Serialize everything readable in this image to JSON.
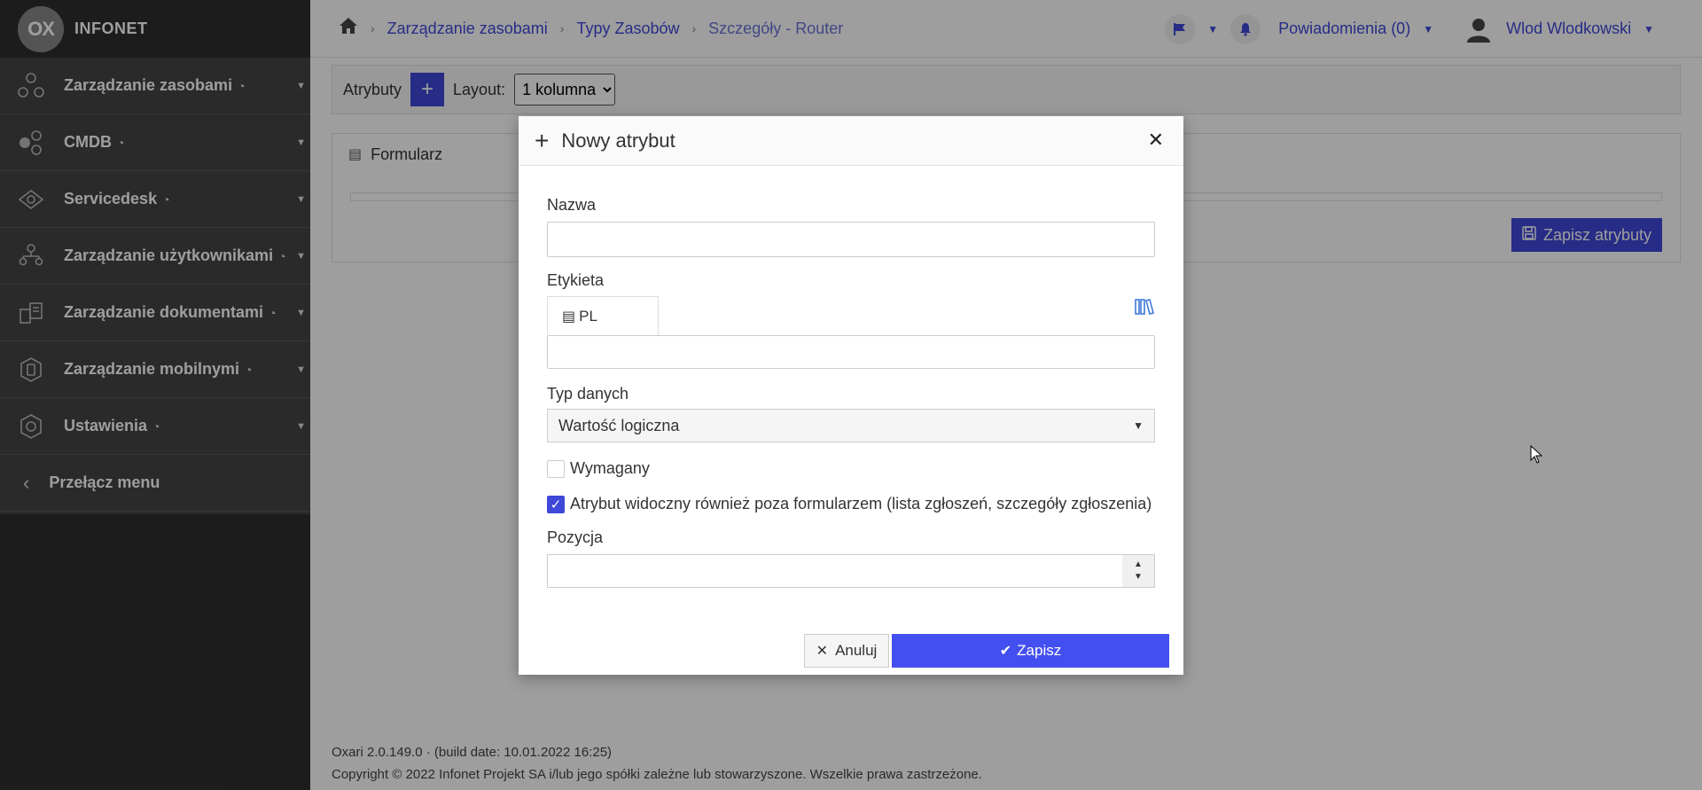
{
  "app": {
    "brand_logo": "OX",
    "brand_name": "INFONET"
  },
  "sidebar": {
    "items": [
      {
        "label": "Zarządzanie zasobami",
        "icon": "hexagon-nodes-icon"
      },
      {
        "label": "CMDB",
        "icon": "cubes-icon"
      },
      {
        "label": "Servicedesk",
        "icon": "eye-diamond-icon"
      },
      {
        "label": "Zarządzanie użytkownikami",
        "icon": "users-tree-icon"
      },
      {
        "label": "Zarządzanie dokumentami",
        "icon": "documents-icon"
      },
      {
        "label": "Zarządzanie mobilnymi",
        "icon": "mobile-icon"
      },
      {
        "label": "Ustawienia",
        "icon": "gear-hex-icon"
      }
    ],
    "toggle_label": "Przełącz menu"
  },
  "header": {
    "breadcrumbs": [
      "Zarządzanie zasobami",
      "Typy Zasobów",
      "Szczegóły - Router"
    ],
    "notifications_label": "Powiadomienia",
    "notifications_count": "(0)",
    "user_name": "Wlod Wlodkowski"
  },
  "toolbar": {
    "attributes_label": "Atrybuty",
    "layout_label": "Layout:",
    "layout_value": "1 kolumna"
  },
  "panel": {
    "title": "Formularz",
    "save_attributes_label": "Zapisz atrybuty"
  },
  "modal": {
    "title": "Nowy atrybut",
    "name_label": "Nazwa",
    "name_value": "",
    "label_label": "Etykieta",
    "lang_tab": "PL",
    "label_value": "",
    "datatype_label": "Typ danych",
    "datatype_value": "Wartość logiczna",
    "required_label": "Wymagany",
    "required_checked": false,
    "visible_label": "Atrybut widoczny również poza formularzem (lista zgłoszeń, szczegóły zgłoszenia)",
    "visible_checked": true,
    "position_label": "Pozycja",
    "position_value": "",
    "cancel_label": "Anuluj",
    "save_label": "Zapisz"
  },
  "footer": {
    "version_line": "Oxari 2.0.149.0  ·  (build date: 10.01.2022 16:25)",
    "copyright_line": "Copyright © 2022 Infonet Projekt SA i/lub jego spółki zależne lub stowarzyszone. Wszelkie prawa zastrzeżone."
  },
  "colors": {
    "accent": "#3f48d8",
    "sidebar_bg": "#444444",
    "sidebar_dark": "#2e2e2e"
  }
}
